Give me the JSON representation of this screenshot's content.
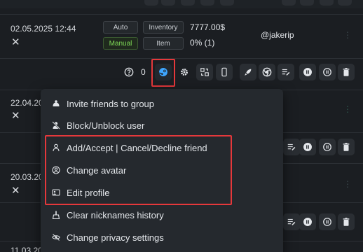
{
  "row1": {
    "datetime": "02.05.2025 12:44",
    "close_glyph": "✕",
    "tag_auto": "Auto",
    "tag_manual": "Manual",
    "tag_inventory": "Inventory",
    "tag_item": "Item",
    "balance": "7777.00$",
    "percent": "0% (1)",
    "username": "@jakerip",
    "more_glyph": "⋮"
  },
  "actions": {
    "counter": "0",
    "icons": [
      "help-circle-icon",
      "steam-icon",
      "gear-icon",
      "swap-icon",
      "phone-icon",
      "rocket-icon",
      "chrome-icon",
      "list-edit-icon",
      "pause-icon",
      "pause-icon",
      "trash-icon"
    ]
  },
  "row2": {
    "datetime": "22.04.20",
    "close_glyph": "✕"
  },
  "row3": {
    "datetime": "20.03.20",
    "close_glyph": "✕"
  },
  "row4": {
    "datetime": "11.03.20"
  },
  "menu": {
    "items": [
      {
        "label": "Invite friends to group",
        "icon": "group-icon"
      },
      {
        "label": "Block/Unblock user",
        "icon": "user-block-icon"
      },
      {
        "label": "Add/Accept | Cancel/Decline friend",
        "icon": "user-icon"
      },
      {
        "label": "Change avatar",
        "icon": "avatar-icon"
      },
      {
        "label": "Edit profile",
        "icon": "edit-profile-icon"
      },
      {
        "label": "Clear nicknames history",
        "icon": "broom-icon"
      },
      {
        "label": "Change privacy settings",
        "icon": "eye-off-icon"
      }
    ]
  },
  "colors": {
    "background": "#1b1e22",
    "highlight": "#e5383b",
    "accent_green": "#7ed957",
    "steam_blue": "#3ea6ff"
  }
}
